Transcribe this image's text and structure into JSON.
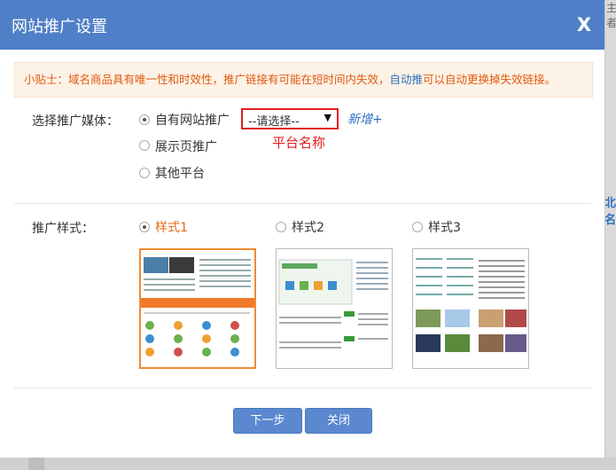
{
  "background": {
    "right_edge_text": "主者",
    "right_edge_link": "北名"
  },
  "dialog": {
    "title": "网站推广设置",
    "close_label": "X",
    "tip": {
      "prefix": "小贴士：域名商品具有唯一性和时效性，推广链接有可能在短时间内失效，",
      "link": "自动推",
      "suffix": "可以自动更换掉失效链接。"
    },
    "media": {
      "label": "选择推广媒体：",
      "options": [
        "自有网站推广",
        "展示页推广",
        "其他平台"
      ],
      "selected_index": 0,
      "select": {
        "value": "--请选择--",
        "arrow": "▼"
      },
      "add_link": "新增+",
      "annotation": "平台名称"
    },
    "style": {
      "label": "推广样式：",
      "options": [
        "样式1",
        "样式2",
        "样式3"
      ],
      "selected_index": 0
    },
    "buttons": {
      "next": "下一步",
      "close": "关闭"
    }
  },
  "colors": {
    "header": "#4f7fc7",
    "tip_text": "#e05a10",
    "link": "#2e6fbf",
    "annotation_red": "#e02020",
    "selected_orange": "#e86a0f",
    "button": "#5b88cf"
  }
}
